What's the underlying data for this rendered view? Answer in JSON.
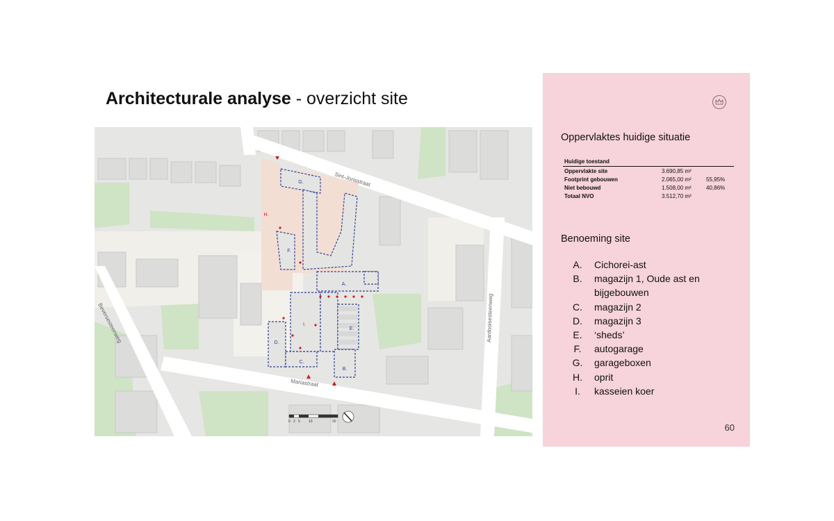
{
  "slide": {
    "title_bold": "Architecturale analyse",
    "title_rest": " - overzicht site",
    "page_number": "60"
  },
  "map": {
    "streets": [
      "Sint-Jorisstraat",
      "Mariastraat",
      "Beversesteenweg",
      "Aardooisesteenweg"
    ],
    "zone_labels": [
      "A.",
      "B.",
      "C.",
      "D.",
      "E.",
      "F.",
      "G.",
      "H.",
      "I."
    ],
    "scale_labels": [
      "0",
      "2",
      "5",
      "10",
      "20"
    ]
  },
  "panel": {
    "section1_title": "Oppervlaktes huidige situatie",
    "table": {
      "header": "Huidige toestand",
      "rows": [
        {
          "label": "Oppervlakte site",
          "value": "3.690,85 m²",
          "pct": ""
        },
        {
          "label": "Footprint gebouwen",
          "value": "2.065,00 m²",
          "pct": "55,95%"
        },
        {
          "label": "Niet bebouwd",
          "value": "1.508,00 m²",
          "pct": "40,86%"
        },
        {
          "label": "Totaal NVO",
          "value": "3.512,70 m²",
          "pct": ""
        }
      ]
    },
    "section2_title": "Benoeming site",
    "items": [
      {
        "letter": "A.",
        "text": "Cichorei-ast"
      },
      {
        "letter": "B.",
        "text": "magazijn 1, Oude ast en bijgebouwen"
      },
      {
        "letter": "C.",
        "text": "magazijn 2"
      },
      {
        "letter": "D.",
        "text": "magazijn 3"
      },
      {
        "letter": "E.",
        "text": "‘sheds’"
      },
      {
        "letter": "F.",
        "text": "autogarage"
      },
      {
        "letter": "G.",
        "text": "garageboxen"
      },
      {
        "letter": "H.",
        "text": "oprit"
      },
      {
        "letter": "I.",
        "text": "kasseien koer"
      }
    ]
  },
  "colors": {
    "panel_bg": "#f7d3db",
    "site_outline": "#2e3f8f",
    "courtyard": "#eaa28e",
    "driveway": "#f3ded4",
    "marker": "#c81e1e",
    "greenery": "#cfe3c5"
  }
}
